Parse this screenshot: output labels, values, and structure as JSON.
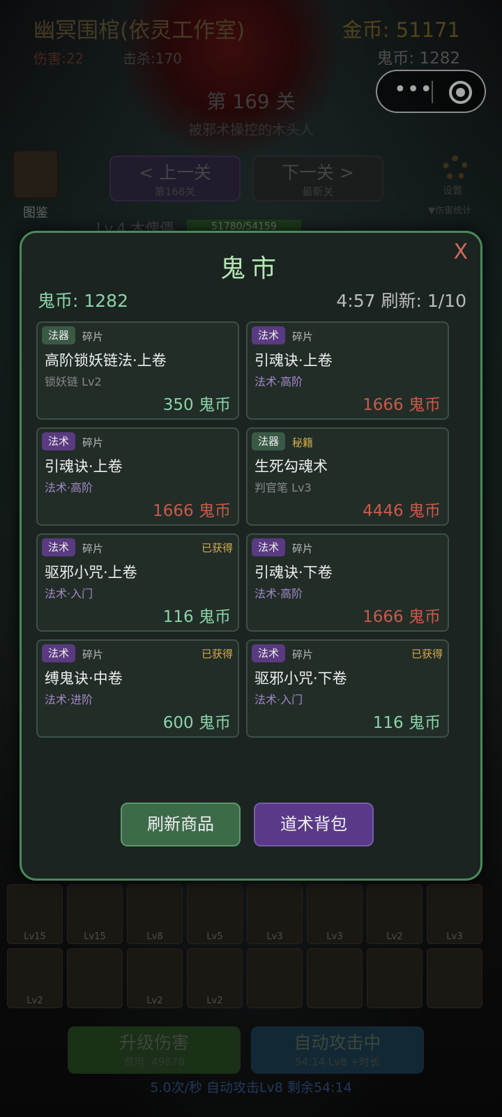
{
  "header": {
    "game_title": "幽冥围棺(依灵工作室)",
    "gold": "金币: 51171",
    "damage": "伤害:22",
    "kills": "击杀:170",
    "ghost_coin": "鬼币: 1282",
    "level_title": "第 169 关",
    "level_subtitle": "被邪术操控的木头人"
  },
  "nav": {
    "codex_label": "图鉴",
    "prev_label": "< 上一关",
    "prev_sub": "第168关",
    "next_label": "下一关 >",
    "next_sub": "最新关",
    "settings_label": "设置",
    "damage_stats": "▼伤害统计"
  },
  "enemy": {
    "name": "Lv.4 木傀儡",
    "hp": "51780/54159"
  },
  "modal": {
    "title": "鬼市",
    "close": "X",
    "ghost_coin": "鬼币: 1282",
    "refresh_info": "4:57 刷新: 1/10",
    "items": [
      {
        "tag": "法器",
        "kind": "碎片",
        "owned": "",
        "name": "高阶锁妖链法·上卷",
        "desc": "锁妖链 Lv2",
        "price": "350 鬼币"
      },
      {
        "tag": "法术",
        "kind": "碎片",
        "owned": "",
        "name": "引魂诀·上卷",
        "desc": "法术·高阶",
        "price": "1666 鬼币"
      },
      {
        "tag": "法术",
        "kind": "碎片",
        "owned": "",
        "name": "引魂诀·上卷",
        "desc": "法术·高阶",
        "price": "1666 鬼币"
      },
      {
        "tag": "法器",
        "kind": "秘籍",
        "owned": "",
        "name": "生死勾魂术",
        "desc": "判官笔 Lv3",
        "price": "4446 鬼币"
      },
      {
        "tag": "法术",
        "kind": "碎片",
        "owned": "已获得",
        "name": "驱邪小咒·上卷",
        "desc": "法术·入门",
        "price": "116 鬼币"
      },
      {
        "tag": "法术",
        "kind": "碎片",
        "owned": "",
        "name": "引魂诀·下卷",
        "desc": "法术·高阶",
        "price": "1666 鬼币"
      },
      {
        "tag": "法术",
        "kind": "碎片",
        "owned": "已获得",
        "name": "缚鬼诀·中卷",
        "desc": "法术·进阶",
        "price": "600 鬼币"
      },
      {
        "tag": "法术",
        "kind": "碎片",
        "owned": "已获得",
        "name": "驱邪小咒·下卷",
        "desc": "法术·入门",
        "price": "116 鬼币"
      }
    ],
    "refresh_button": "刷新商品",
    "bag_button": "道术背包"
  },
  "skills": [
    {
      "level": "Lv15"
    },
    {
      "level": "Lv15"
    },
    {
      "level": "Lv8"
    },
    {
      "level": "Lv5"
    },
    {
      "level": "Lv3"
    },
    {
      "level": "Lv3"
    },
    {
      "level": "Lv2"
    },
    {
      "level": "Lv3"
    },
    {
      "level": "Lv2"
    },
    {
      "level": ""
    },
    {
      "level": "Lv2"
    },
    {
      "level": "Lv2"
    },
    {
      "level": ""
    },
    {
      "level": ""
    },
    {
      "level": ""
    },
    {
      "level": ""
    }
  ],
  "bottom": {
    "upgrade_label": "升级伤害",
    "upgrade_cost": "费用: 49878",
    "auto_label": "自动攻击中",
    "auto_info": "54:14  Lv8  +时长",
    "status": "5.0次/秒  自动攻击Lv8  剩余54:14"
  },
  "colors": {
    "modal_border": "#4a8a5a",
    "title_green": "#b4e6b4",
    "price_green": "#8ad4a8",
    "price_red": "#c85a4a",
    "spell_purple": "#5a3a80",
    "owned_gold": "#d4aa4a"
  }
}
